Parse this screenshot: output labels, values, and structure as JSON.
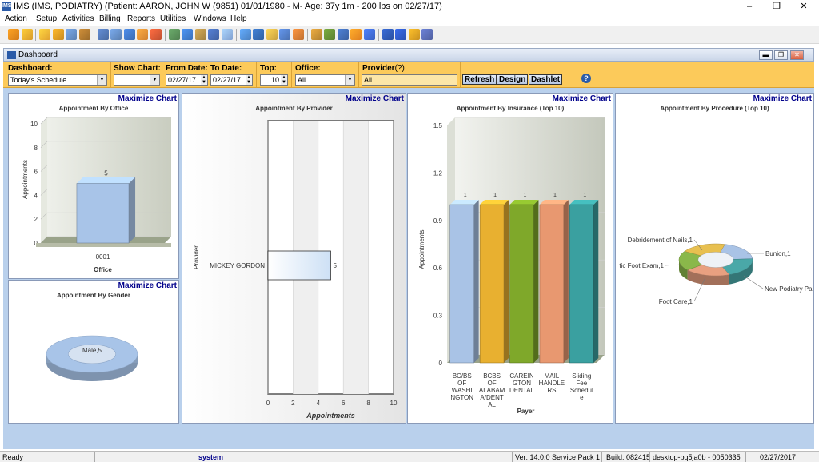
{
  "window": {
    "title": "IMS (IMS, PODIATRY)    (Patient: AARON, JOHN W (9851) 01/01/1980 - M- Age: 37y 1m - 200 lbs on 02/27/17)",
    "app_icon": "ims-icon",
    "controls": {
      "minimize": "–",
      "restore": "❐",
      "close": "✕"
    }
  },
  "menu": [
    "Action",
    "Setup",
    "Activities",
    "Billing",
    "Reports",
    "Utilities",
    "Windows",
    "Help"
  ],
  "toolbar": {
    "icons": [
      "user-icon",
      "users-icon",
      "folder-open-icon",
      "folder-icon",
      "print-icon",
      "lab-flask-icon",
      "document-icon",
      "form-icon",
      "dollar-icon",
      "billing-icon",
      "report-icon",
      "transfer-icon",
      "calendar-icon",
      "tools-icon",
      "edit-icon",
      "pen-icon",
      "box-icon",
      "camera-icon",
      "chart-icon",
      "grid-icon",
      "building-icon",
      "stack-icon",
      "money-icon",
      "exchange-icon",
      "word-icon",
      "spreadsheet-icon",
      "display-icon",
      "help-icon",
      "lock-icon",
      "exit-icon"
    ],
    "colors": [
      "#d27a1a",
      "#d89a2a",
      "#e0a030",
      "#c98a20",
      "#5a7fb0",
      "#9a6a2a",
      "#4a6aa0",
      "#5a7fb0",
      "#3a6ab0",
      "#d08030",
      "#c05030",
      "#508050",
      "#3a70b8",
      "#a08040",
      "#4060a0",
      "#80a0d0",
      "#4a80c0",
      "#3060a0",
      "#c8a040",
      "#4a70b0",
      "#c07030",
      "#b08030",
      "#5a8030",
      "#3a60a0",
      "#e08020",
      "#3a60c0",
      "#2a50a0",
      "#2a50b0",
      "#c89020",
      "#5060a0"
    ]
  },
  "dashboard": {
    "title": "Dashboard",
    "title_icon": "dashboard-icon",
    "mdi_controls": {
      "minimize": "▬",
      "restore": "❐",
      "close": "✕"
    },
    "filters": {
      "dashboard_label": "Dashboard:",
      "dashboard_value": "Today's Schedule",
      "show_chart_label": "Show Chart:",
      "show_chart_value": "",
      "from_date_label": "From Date:",
      "from_date_value": "02/27/17",
      "to_date_label": "To Date:",
      "to_date_value": "02/27/17",
      "top_label": "Top:",
      "top_value": "10",
      "office_label": "Office:",
      "office_value": "All",
      "provider_label": "Provider",
      "provider_hint": "(?)",
      "provider_value": "All"
    },
    "buttons": {
      "refresh": "Refresh",
      "design": "Design",
      "dashlet": "Dashlet"
    },
    "help_icon": "?"
  },
  "panels": {
    "maximize_label": "Maximize Chart",
    "office_title": "Appointment By Office",
    "gender_title": "Appointment By Gender",
    "provider_title": "Appointment By Provider",
    "insurance_title": "Appointment By Insurance (Top 10)",
    "procedure_title": "Appointment By Procedure (Top 10)"
  },
  "chart_data": [
    {
      "id": "office",
      "type": "bar",
      "title": "Appointment By Office",
      "xlabel": "Office",
      "ylabel": "Appointments",
      "categories": [
        "0001"
      ],
      "values": [
        5
      ],
      "ylim": [
        0,
        10
      ],
      "yticks": [
        0,
        2,
        4,
        6,
        8,
        10
      ],
      "data_labels": [
        "5"
      ],
      "colors": [
        "#a8c4e8"
      ]
    },
    {
      "id": "gender",
      "type": "pie",
      "title": "Appointment By Gender",
      "categories": [
        "Male"
      ],
      "values": [
        5
      ],
      "data_labels": [
        "Male,5"
      ],
      "colors": [
        "#a8c4e8"
      ]
    },
    {
      "id": "provider",
      "type": "bar",
      "title": "Appointment By Provider",
      "xlabel": "Appointments",
      "ylabel": "Provider",
      "categories": [
        "MICKEY GORDON"
      ],
      "values": [
        5
      ],
      "xlim": [
        0,
        10
      ],
      "xticks": [
        0,
        2,
        4,
        6,
        8,
        10
      ],
      "data_labels": [
        "5"
      ],
      "colors": [
        "#cde0f5"
      ]
    },
    {
      "id": "insurance",
      "type": "bar",
      "title": "Appointment By Insurance (Top 10)",
      "xlabel": "Payer",
      "ylabel": "Appointments",
      "categories": [
        "BC/BS OF WASHINGTON",
        "BCBS OF ALABAMA/DENTAL",
        "CAREINGTON DENTAL",
        "MAIL HANDLERS",
        "Sliding Fee Schedule"
      ],
      "category_lines": [
        [
          "BC/BS",
          "OF",
          "WASHI",
          "NGTON"
        ],
        [
          "BCBS",
          "OF",
          "ALABAM",
          "A/DENT",
          "AL"
        ],
        [
          "CAREIN",
          "GTON",
          "DENTAL"
        ],
        [
          "MAIL",
          "HANDLE",
          "RS"
        ],
        [
          "Sliding",
          "Fee",
          "Schedul",
          "e"
        ]
      ],
      "values": [
        1,
        1,
        1,
        1,
        1
      ],
      "ylim": [
        0,
        1.5
      ],
      "yticks": [
        "0",
        "0.3",
        "0.6",
        "0.9",
        "1.2",
        "1.5"
      ],
      "data_labels": [
        "1",
        "1",
        "1",
        "1",
        "1"
      ],
      "colors": [
        "#a9c3e6",
        "#e8b030",
        "#7fa82a",
        "#e89870",
        "#3aa0a0"
      ]
    },
    {
      "id": "procedure",
      "type": "pie",
      "title": "Appointment By Procedure (Top 10)",
      "categories": [
        "Bunion",
        "New Podiatry Pa",
        "Foot Care",
        "tic Foot Exam",
        "Debridement of Nails"
      ],
      "values": [
        1,
        1,
        1,
        1,
        1
      ],
      "data_labels": [
        "Bunion,1",
        "New Podiatry Pa",
        "Foot Care,1",
        "tic Foot Exam,1",
        "Debridement of Nails,1"
      ],
      "colors": [
        "#a9c3e6",
        "#4aa8a8",
        "#e8a080",
        "#8ab84a",
        "#e8c050"
      ]
    }
  ],
  "status": {
    "ready": "Ready",
    "user": "system",
    "version": "Ver: 14.0.0 Service Pack 1",
    "build": "Build: 082415",
    "machine": "desktop-bq5ja0b - 0050335",
    "date": "02/27/2017"
  }
}
